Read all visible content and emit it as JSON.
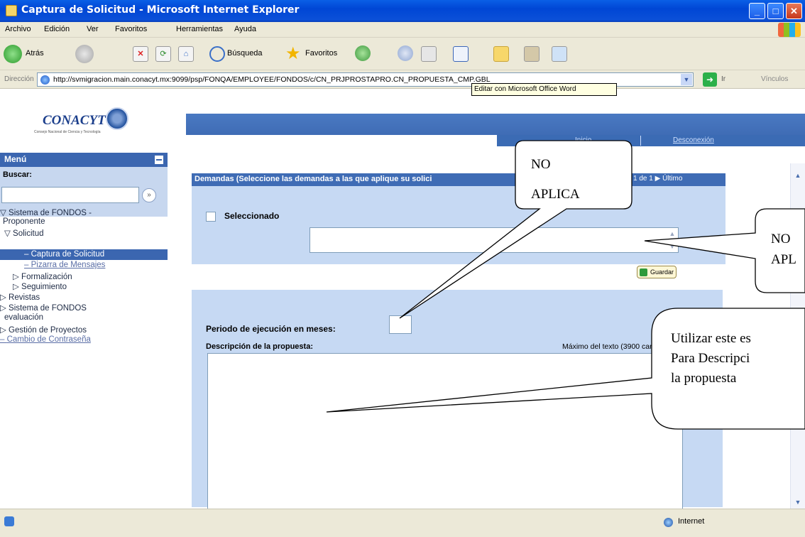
{
  "window": {
    "title": "Captura de Solicitud - Microsoft Internet Explorer",
    "minimize": "_",
    "maximize": "□",
    "close": "✕"
  },
  "menubar": [
    "Archivo",
    "Edición",
    "Ver",
    "Favoritos",
    "Herramientas",
    "Ayuda"
  ],
  "toolbar": {
    "back": "Atrás",
    "search": "Búsqueda",
    "favorites": "Favoritos",
    "tooltip": "Editar con Microsoft Office Word"
  },
  "address": {
    "label": "Dirección",
    "url": "http://svmigracion.main.conacyt.mx:9099/psp/FONQA/EMPLOYEE/FONDOS/c/CN_PRJPROSTAPRO.CN_PROPUESTA_CMP.GBL",
    "go": "Ir",
    "links": "Vínculos"
  },
  "header": {
    "logo": "CONACYT",
    "logo_sub": "Consejo Nacional de Ciencia y Tecnología",
    "inicio": "Inicio",
    "desconexion": "Desconexión"
  },
  "menu": {
    "title": "Menú",
    "buscar": "Buscar:",
    "search_go": "»",
    "items": {
      "sistema_proponente": "Sistema de FONDOS -",
      "sistema_proponente_2": "Proponente",
      "solicitud": "Solicitud",
      "captura": "Captura de Solicitud",
      "pizarra": "Pizarra de Mensajes",
      "formalizacion": "Formalización",
      "seguimiento": "Seguimiento",
      "revistas": "Revistas",
      "sistema_evaluacion": "Sistema de FONDOS",
      "sistema_evaluacion_2": "evaluación",
      "gestion": "Gestión de Proyectos",
      "cambio": "Cambio de Contraseña"
    }
  },
  "demandas": {
    "header": "Demandas (Seleccione las demandas a las que aplique su solici",
    "nav": "1 de 1",
    "nav_last": "Último",
    "seleccionado": "Seleccionado"
  },
  "guardar": "Guardar",
  "propuesta": {
    "periodo_label": "Periodo de ejecución en meses:",
    "descripcion_label": "Descripción de la propuesta:",
    "maximo": "Máximo del texto (3900 caract"
  },
  "status": {
    "zone": "Internet"
  },
  "callouts": {
    "c1_line1": "NO",
    "c1_line2": "APLICA",
    "c2_line1": "NO",
    "c2_line2": "APL",
    "c3_line1": "Utilizar este es",
    "c3_line2": "Para Descripci",
    "c3_line3": "la propuesta"
  }
}
